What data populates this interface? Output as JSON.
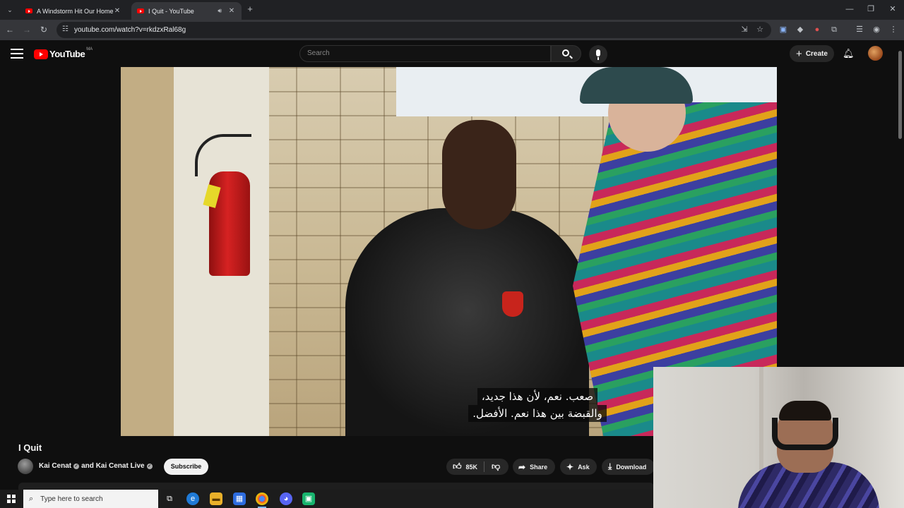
{
  "browser": {
    "tabs": [
      {
        "title": "A Windstorm Hit Our Homeste",
        "active": false
      },
      {
        "title": "I Quit - YouTube",
        "active": true
      }
    ],
    "url": "youtube.com/watch?v=rkdzxRal68g"
  },
  "youtube": {
    "country_code": "MA",
    "logo_text": "YouTube",
    "search_placeholder": "Search",
    "create_label": "Create"
  },
  "video": {
    "subtitle_line1": "صعب. نعم، لأن هذا جديد،",
    "subtitle_line2": "والقبضة بين هذا نعم. الأفضل."
  },
  "meta": {
    "title": "I Quit",
    "channel": "Kai Cenat",
    "channel_joiner": "and",
    "channel2": "Kai Cenat Live",
    "subscribe_label": "Subscribe",
    "likes": "85K",
    "share_label": "Share",
    "ask_label": "Ask",
    "download_label": "Download"
  },
  "taskbar": {
    "search_placeholder": "Type here to search"
  },
  "colors": {
    "brand": "#ff0000",
    "background": "#0f0f0f",
    "pill": "#272727"
  }
}
